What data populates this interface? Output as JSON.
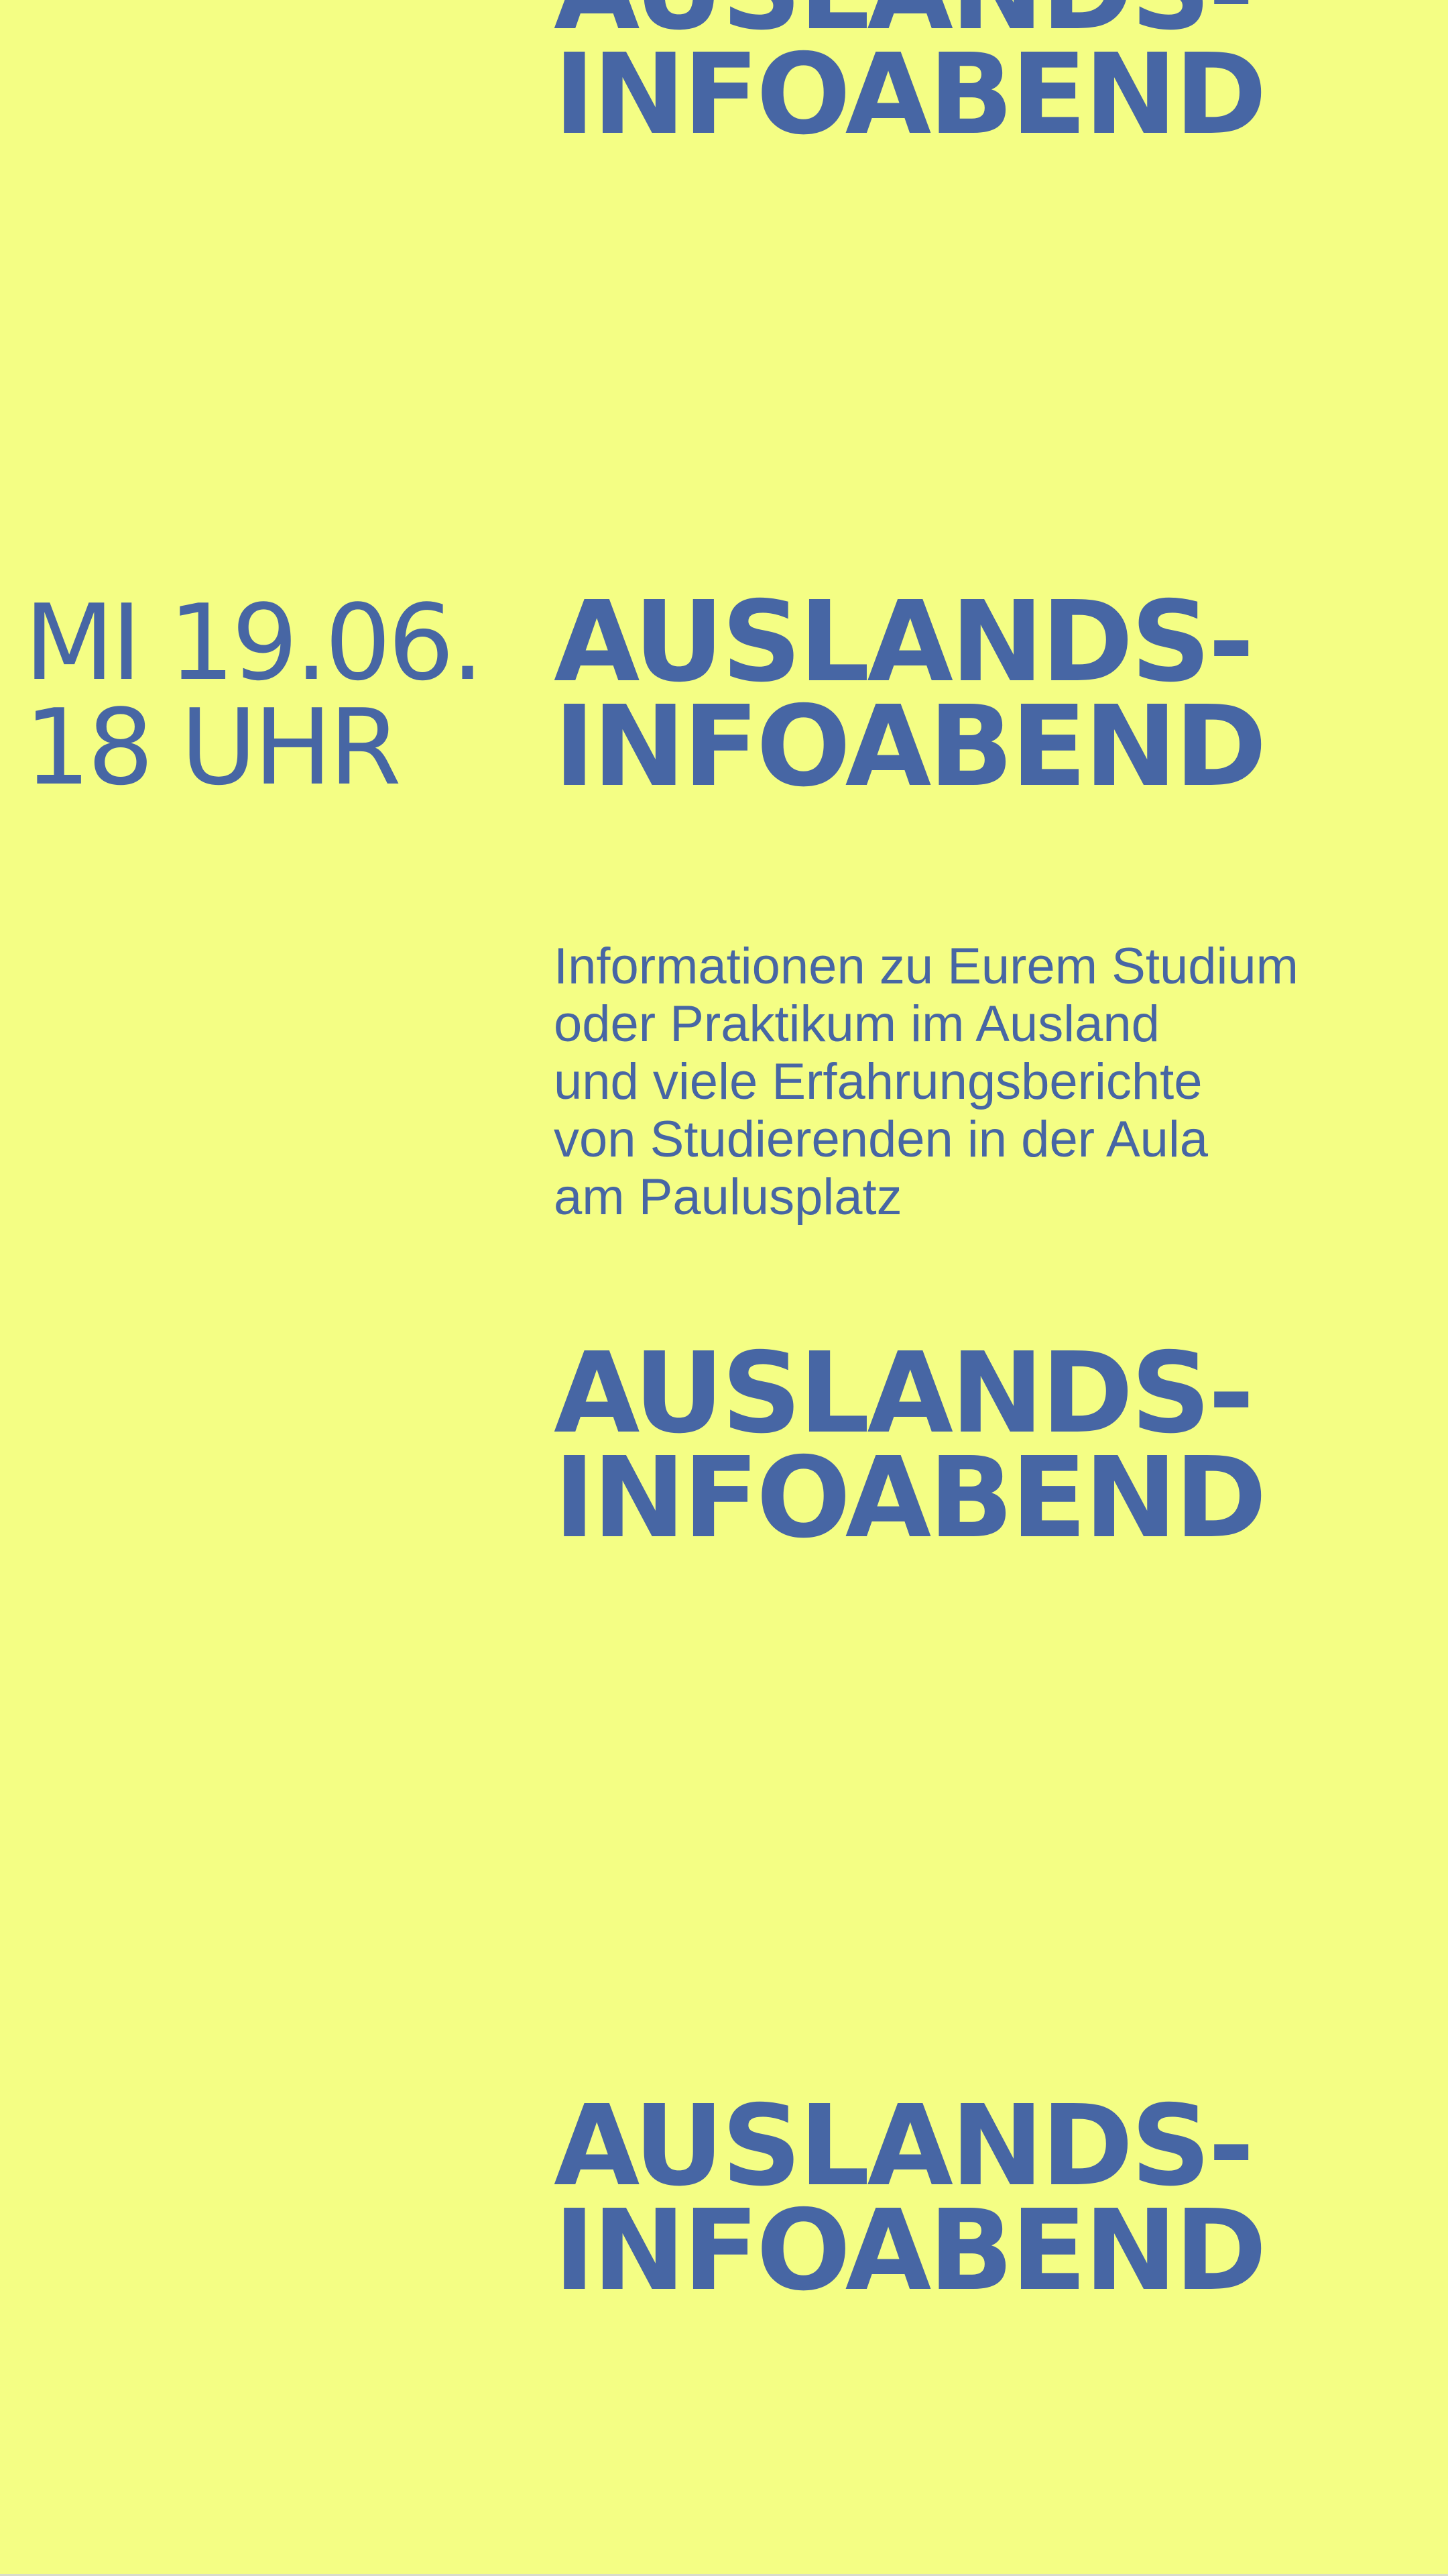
{
  "colors": {
    "background": "#f4fe84",
    "text": "#4766a4"
  },
  "headline_repeats": [
    {
      "line1": "AUSLANDS-",
      "line2": "INFOABEND"
    },
    {
      "line1": "AUSLANDS-",
      "line2": "INFOABEND"
    },
    {
      "line1": "AUSLANDS-",
      "line2": "INFOABEND"
    },
    {
      "line1": "AUSLANDS-",
      "line2": "INFOABEND"
    }
  ],
  "event": {
    "date": "MI 19.06.",
    "time": "18 UHR",
    "description_lines": [
      "Informationen zu Eurem Studium",
      "oder Praktikum im Ausland",
      "und viele Erfahrungsberichte",
      "von Studierenden in der Aula",
      "am Paulusplatz"
    ]
  }
}
